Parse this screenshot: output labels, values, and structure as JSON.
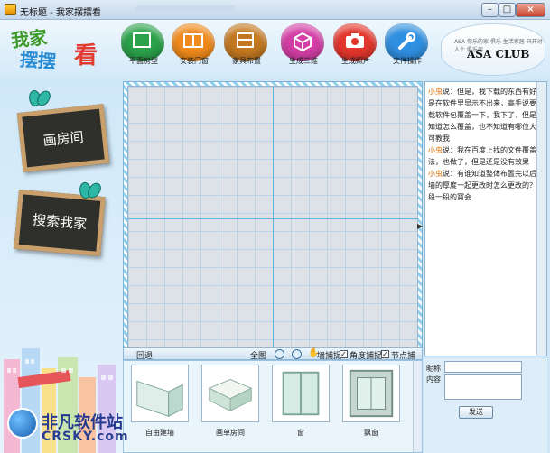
{
  "window": {
    "title": "无标题 - 我家摆摆看"
  },
  "logo": {
    "line1": "我家",
    "line2": "摆摆",
    "line3": "看"
  },
  "tools": [
    {
      "label": "平面房型",
      "icon": "square-icon",
      "color": "#2aa14a"
    },
    {
      "label": "安装门窗",
      "icon": "door-icon",
      "color": "#f08a1c"
    },
    {
      "label": "家具布置",
      "icon": "furniture-icon",
      "color": "#c27821"
    },
    {
      "label": "生成三维",
      "icon": "cube-icon",
      "color": "#d33fa6"
    },
    {
      "label": "生成照片",
      "icon": "camera-icon",
      "color": "#e3362c"
    },
    {
      "label": "文件操作",
      "icon": "wrench-icon",
      "color": "#2f8fe0"
    }
  ],
  "club": {
    "small": "ASA 你乐的家 俱乐 生活家居 只开对人士 俱乐部",
    "name": "ASA CLUB"
  },
  "left": {
    "draw": "画房间",
    "search": "搜索我家"
  },
  "toolbar": {
    "undo": "回退",
    "all": "全图",
    "wall": "墙捕捉",
    "angle": "角度捕捉",
    "node": "节点捕捉"
  },
  "items": [
    {
      "label": "自由建墙",
      "icon": "wall-icon"
    },
    {
      "label": "画单房间",
      "icon": "room-icon"
    },
    {
      "label": "窗",
      "icon": "window-icon"
    },
    {
      "label": "飘窗",
      "icon": "bay-window-icon"
    }
  ],
  "chat": {
    "messages": [
      {
        "name": "小虫",
        "sep": "说：",
        "text": "但是，我下载的东西有好多是在软件里显示不出来，高手说要下载软件包覆盖一下，我下了，但是不知道怎么覆盖，也不知道有哪位大侠可教我"
      },
      {
        "name": "小虫",
        "sep": "说：",
        "text": "我在百度上找的文件覆盖方法，也做了，但是还是没有效果"
      },
      {
        "name": "小虫",
        "sep": "说：",
        "text": "有谁知道整体布置完以后，墙的厚度一起更改时怎么更改的？一段一段的寶会"
      }
    ]
  },
  "compose": {
    "nick_label": "昵称",
    "content_label": "内容",
    "send": "发送"
  },
  "watermark": {
    "line1": "非凡软件站",
    "line2": "CRSKY.com"
  }
}
